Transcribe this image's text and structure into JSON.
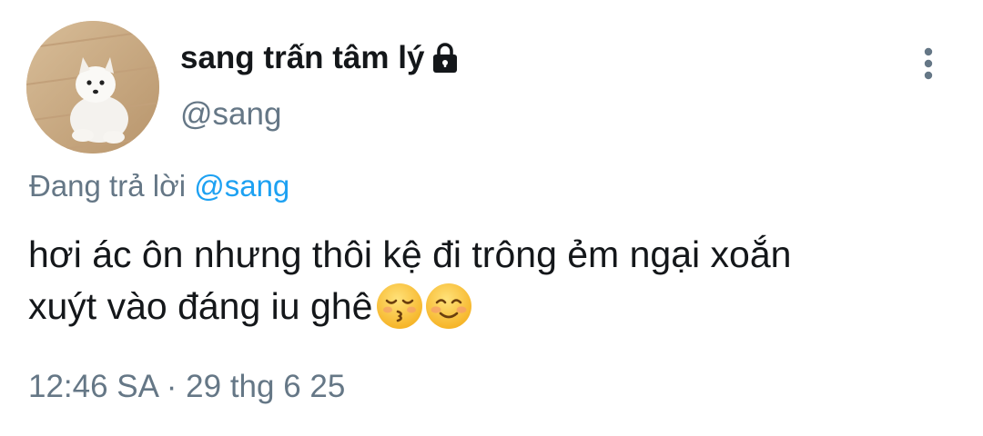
{
  "author": {
    "display_name": "sang trấn tâm lý",
    "handle": "@sang",
    "protected_icon": "lock-icon",
    "avatar_icon": "white-puppy-photo"
  },
  "reply": {
    "prefix": "Đang trả lời",
    "mention": "@sang"
  },
  "tweet": {
    "line1": "hơi ác ôn nhưng thôi kệ đi trông ẻm ngại xoắn",
    "line2": "xuýt vào đáng iu ghê",
    "emojis": [
      "kissing-face-closed-eyes",
      "smiling-face"
    ]
  },
  "meta": {
    "timestamp": "12:46 SA · 29 thg 6 25"
  },
  "menu": {
    "icon": "more-vertical-icon"
  },
  "colors": {
    "text": "#14171a",
    "secondary": "#657786",
    "link": "#1da1f2"
  }
}
